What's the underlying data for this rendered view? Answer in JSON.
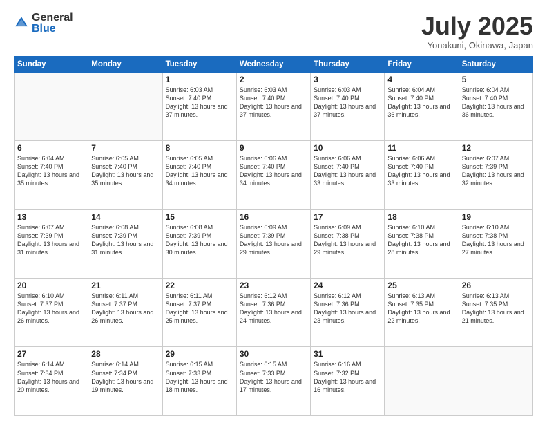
{
  "logo": {
    "general": "General",
    "blue": "Blue"
  },
  "title": "July 2025",
  "location": "Yonakuni, Okinawa, Japan",
  "days_of_week": [
    "Sunday",
    "Monday",
    "Tuesday",
    "Wednesday",
    "Thursday",
    "Friday",
    "Saturday"
  ],
  "weeks": [
    [
      {
        "day": "",
        "info": ""
      },
      {
        "day": "",
        "info": ""
      },
      {
        "day": "1",
        "info": "Sunrise: 6:03 AM\nSunset: 7:40 PM\nDaylight: 13 hours and 37 minutes."
      },
      {
        "day": "2",
        "info": "Sunrise: 6:03 AM\nSunset: 7:40 PM\nDaylight: 13 hours and 37 minutes."
      },
      {
        "day": "3",
        "info": "Sunrise: 6:03 AM\nSunset: 7:40 PM\nDaylight: 13 hours and 37 minutes."
      },
      {
        "day": "4",
        "info": "Sunrise: 6:04 AM\nSunset: 7:40 PM\nDaylight: 13 hours and 36 minutes."
      },
      {
        "day": "5",
        "info": "Sunrise: 6:04 AM\nSunset: 7:40 PM\nDaylight: 13 hours and 36 minutes."
      }
    ],
    [
      {
        "day": "6",
        "info": "Sunrise: 6:04 AM\nSunset: 7:40 PM\nDaylight: 13 hours and 35 minutes."
      },
      {
        "day": "7",
        "info": "Sunrise: 6:05 AM\nSunset: 7:40 PM\nDaylight: 13 hours and 35 minutes."
      },
      {
        "day": "8",
        "info": "Sunrise: 6:05 AM\nSunset: 7:40 PM\nDaylight: 13 hours and 34 minutes."
      },
      {
        "day": "9",
        "info": "Sunrise: 6:06 AM\nSunset: 7:40 PM\nDaylight: 13 hours and 34 minutes."
      },
      {
        "day": "10",
        "info": "Sunrise: 6:06 AM\nSunset: 7:40 PM\nDaylight: 13 hours and 33 minutes."
      },
      {
        "day": "11",
        "info": "Sunrise: 6:06 AM\nSunset: 7:40 PM\nDaylight: 13 hours and 33 minutes."
      },
      {
        "day": "12",
        "info": "Sunrise: 6:07 AM\nSunset: 7:39 PM\nDaylight: 13 hours and 32 minutes."
      }
    ],
    [
      {
        "day": "13",
        "info": "Sunrise: 6:07 AM\nSunset: 7:39 PM\nDaylight: 13 hours and 31 minutes."
      },
      {
        "day": "14",
        "info": "Sunrise: 6:08 AM\nSunset: 7:39 PM\nDaylight: 13 hours and 31 minutes."
      },
      {
        "day": "15",
        "info": "Sunrise: 6:08 AM\nSunset: 7:39 PM\nDaylight: 13 hours and 30 minutes."
      },
      {
        "day": "16",
        "info": "Sunrise: 6:09 AM\nSunset: 7:39 PM\nDaylight: 13 hours and 29 minutes."
      },
      {
        "day": "17",
        "info": "Sunrise: 6:09 AM\nSunset: 7:38 PM\nDaylight: 13 hours and 29 minutes."
      },
      {
        "day": "18",
        "info": "Sunrise: 6:10 AM\nSunset: 7:38 PM\nDaylight: 13 hours and 28 minutes."
      },
      {
        "day": "19",
        "info": "Sunrise: 6:10 AM\nSunset: 7:38 PM\nDaylight: 13 hours and 27 minutes."
      }
    ],
    [
      {
        "day": "20",
        "info": "Sunrise: 6:10 AM\nSunset: 7:37 PM\nDaylight: 13 hours and 26 minutes."
      },
      {
        "day": "21",
        "info": "Sunrise: 6:11 AM\nSunset: 7:37 PM\nDaylight: 13 hours and 26 minutes."
      },
      {
        "day": "22",
        "info": "Sunrise: 6:11 AM\nSunset: 7:37 PM\nDaylight: 13 hours and 25 minutes."
      },
      {
        "day": "23",
        "info": "Sunrise: 6:12 AM\nSunset: 7:36 PM\nDaylight: 13 hours and 24 minutes."
      },
      {
        "day": "24",
        "info": "Sunrise: 6:12 AM\nSunset: 7:36 PM\nDaylight: 13 hours and 23 minutes."
      },
      {
        "day": "25",
        "info": "Sunrise: 6:13 AM\nSunset: 7:35 PM\nDaylight: 13 hours and 22 minutes."
      },
      {
        "day": "26",
        "info": "Sunrise: 6:13 AM\nSunset: 7:35 PM\nDaylight: 13 hours and 21 minutes."
      }
    ],
    [
      {
        "day": "27",
        "info": "Sunrise: 6:14 AM\nSunset: 7:34 PM\nDaylight: 13 hours and 20 minutes."
      },
      {
        "day": "28",
        "info": "Sunrise: 6:14 AM\nSunset: 7:34 PM\nDaylight: 13 hours and 19 minutes."
      },
      {
        "day": "29",
        "info": "Sunrise: 6:15 AM\nSunset: 7:33 PM\nDaylight: 13 hours and 18 minutes."
      },
      {
        "day": "30",
        "info": "Sunrise: 6:15 AM\nSunset: 7:33 PM\nDaylight: 13 hours and 17 minutes."
      },
      {
        "day": "31",
        "info": "Sunrise: 6:16 AM\nSunset: 7:32 PM\nDaylight: 13 hours and 16 minutes."
      },
      {
        "day": "",
        "info": ""
      },
      {
        "day": "",
        "info": ""
      }
    ]
  ]
}
